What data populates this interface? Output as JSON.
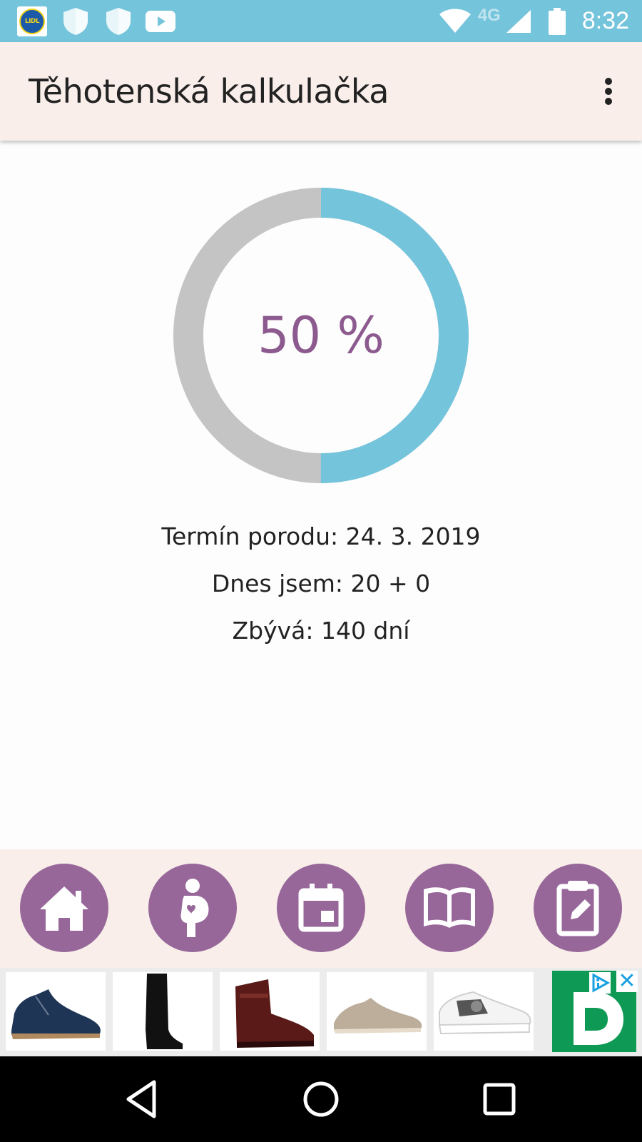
{
  "status_bar": {
    "time": "8:32",
    "network_label": "4G",
    "lidl_logo_text": "LIDL",
    "icons": [
      "lidl-app-icon",
      "shield-icon",
      "shield-icon",
      "youtube-icon",
      "wifi-icon",
      "signal-icon",
      "battery-icon"
    ]
  },
  "app_bar": {
    "title": "Těhotenská kalkulačka",
    "menu_icon": "more-vert-icon"
  },
  "progress": {
    "percent": 50,
    "label": "50 %",
    "colors": {
      "filled": "#74c4dc",
      "empty": "#c4c4c4",
      "text": "#8c5a8e"
    }
  },
  "info": {
    "due_date": "Termín porodu: 24. 3. 2019",
    "today": "Dnes jsem: 20 + 0",
    "remaining": "Zbývá: 140 dní"
  },
  "bottom_nav": {
    "color": "#97679a",
    "items": [
      {
        "icon": "home-icon"
      },
      {
        "icon": "pregnant-woman-icon"
      },
      {
        "icon": "calendar-icon"
      },
      {
        "icon": "book-icon"
      },
      {
        "icon": "notepad-edit-icon"
      }
    ]
  },
  "ad": {
    "items": [
      "blue-suede-shoe",
      "black-knee-boot",
      "brown-leather-boot",
      "beige-suede-shoe",
      "white-sneaker"
    ],
    "choices_icon": "ad-choices-icon",
    "close_label": "✕"
  },
  "system_nav": {
    "icons": [
      "back-icon",
      "home-circle-icon",
      "recents-icon"
    ]
  }
}
